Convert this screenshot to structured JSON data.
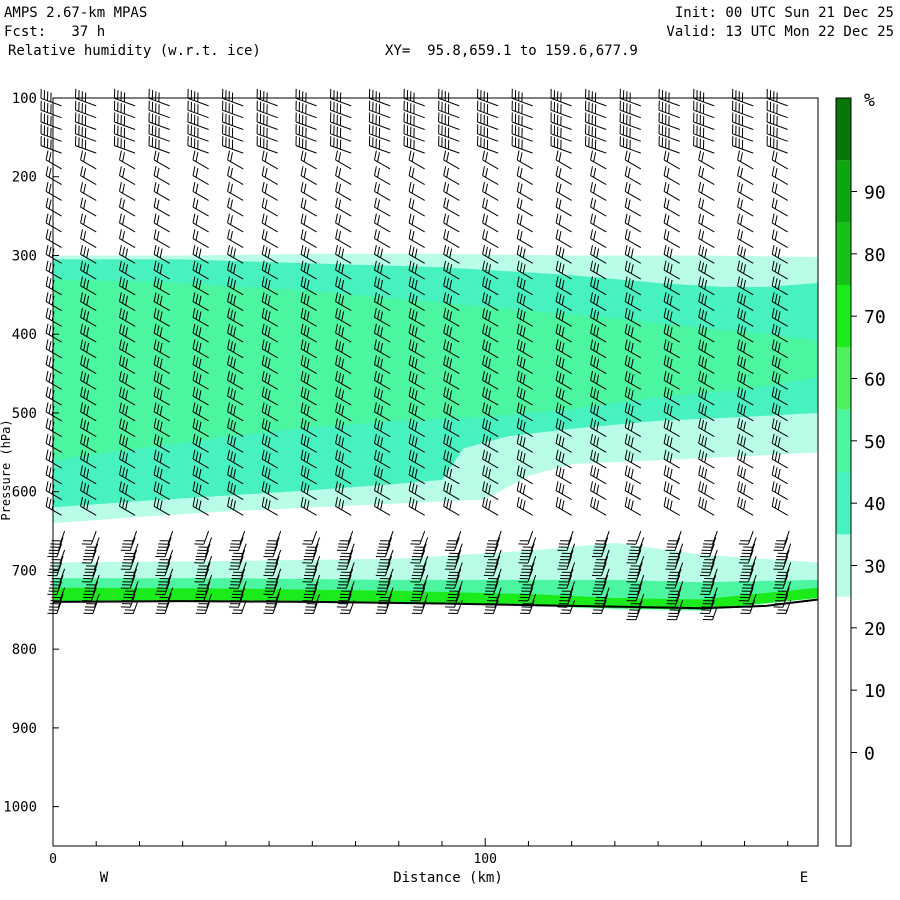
{
  "header": {
    "model": "AMPS 2.67-km MPAS",
    "fcst": "Fcst:   37 h",
    "field": "Relative humidity (w.r.t. ice)",
    "xy": "XY=  95.8,659.1 to 159.6,677.9",
    "init": "Init: 00 UTC Sun 21 Dec 25",
    "valid": "Valid: 13 UTC Mon 22 Dec 25"
  },
  "chart_data": {
    "type": "heatmap",
    "title": "Relative humidity (w.r.t. ice)",
    "xlabel": "Distance (km)",
    "ylabel": "Pressure (hPa)",
    "xlim": [
      0,
      177
    ],
    "ylim": [
      1050,
      100
    ],
    "x_ticks": [
      0,
      100
    ],
    "y_ticks": [
      100,
      200,
      300,
      400,
      500,
      600,
      700,
      800,
      900,
      1000
    ],
    "x_end_labels": {
      "left": "W",
      "right": "E"
    },
    "colorbar": {
      "unit": "%",
      "tick_labels": [
        "0",
        "10",
        "20",
        "30",
        "40",
        "50",
        "60",
        "70",
        "80",
        "90"
      ],
      "levels": [
        -10,
        0,
        10,
        20,
        30,
        40,
        50,
        60,
        70,
        80,
        90,
        100
      ],
      "colors": [
        "#ffffff",
        "#ffffff",
        "#ffffff",
        "#ffffff",
        "#b9fde9",
        "#48f2c0",
        "#4cf59f",
        "#4ff060",
        "#1bea1b",
        "#16c216",
        "#0ea60e",
        "#077607"
      ]
    },
    "regions": [
      {
        "name": "rh-40-50",
        "color": "#b9fde9",
        "upper": [
          [
            0,
            300
          ],
          [
            30,
            300
          ],
          [
            60,
            298
          ],
          [
            90,
            298
          ],
          [
            120,
            300
          ],
          [
            150,
            300
          ],
          [
            177,
            302
          ]
        ],
        "lower": [
          [
            0,
            640
          ],
          [
            20,
            632
          ],
          [
            40,
            625
          ],
          [
            60,
            620
          ],
          [
            80,
            615
          ],
          [
            100,
            610
          ],
          [
            110,
            580
          ],
          [
            120,
            565
          ],
          [
            140,
            560
          ],
          [
            160,
            555
          ],
          [
            177,
            550
          ]
        ]
      },
      {
        "name": "rh-50-60",
        "color": "#48f2c0",
        "upper": [
          [
            0,
            305
          ],
          [
            30,
            305
          ],
          [
            60,
            310
          ],
          [
            90,
            315
          ],
          [
            120,
            325
          ],
          [
            140,
            335
          ],
          [
            155,
            340
          ],
          [
            165,
            340
          ],
          [
            177,
            335
          ]
        ],
        "lower": [
          [
            0,
            620
          ],
          [
            20,
            612
          ],
          [
            40,
            605
          ],
          [
            60,
            598
          ],
          [
            80,
            590
          ],
          [
            90,
            585
          ],
          [
            95,
            545
          ],
          [
            105,
            530
          ],
          [
            120,
            520
          ],
          [
            140,
            510
          ],
          [
            160,
            505
          ],
          [
            177,
            500
          ]
        ]
      },
      {
        "name": "rh-60-70",
        "color": "#4cf59f",
        "upper": [
          [
            0,
            330
          ],
          [
            30,
            335
          ],
          [
            60,
            345
          ],
          [
            90,
            360
          ],
          [
            110,
            370
          ],
          [
            130,
            380
          ],
          [
            150,
            392
          ],
          [
            165,
            400
          ],
          [
            177,
            408
          ]
        ],
        "lower": [
          [
            0,
            560
          ],
          [
            20,
            545
          ],
          [
            40,
            530
          ],
          [
            60,
            518
          ],
          [
            80,
            510
          ],
          [
            100,
            505
          ],
          [
            120,
            495
          ],
          [
            140,
            480
          ],
          [
            160,
            470
          ],
          [
            177,
            455
          ]
        ]
      },
      {
        "name": "rh-40-50-low",
        "color": "#b9fde9",
        "upper": [
          [
            0,
            690
          ],
          [
            40,
            688
          ],
          [
            80,
            685
          ],
          [
            110,
            675
          ],
          [
            130,
            665
          ],
          [
            150,
            680
          ],
          [
            177,
            690
          ]
        ],
        "lower": [
          [
            0,
            740
          ],
          [
            40,
            740
          ],
          [
            80,
            742
          ],
          [
            110,
            745
          ],
          [
            130,
            750
          ],
          [
            150,
            752
          ],
          [
            177,
            735
          ]
        ]
      },
      {
        "name": "rh-60-70-low",
        "color": "#4cf59f",
        "upper": [
          [
            0,
            710
          ],
          [
            40,
            710
          ],
          [
            80,
            712
          ],
          [
            110,
            712
          ],
          [
            130,
            712
          ],
          [
            150,
            715
          ],
          [
            177,
            712
          ]
        ],
        "lower": [
          [
            0,
            740
          ],
          [
            40,
            740
          ],
          [
            80,
            742
          ],
          [
            110,
            745
          ],
          [
            130,
            748
          ],
          [
            150,
            750
          ],
          [
            177,
            735
          ]
        ]
      },
      {
        "name": "rh-80-90-low",
        "color": "#1bea1b",
        "upper": [
          [
            0,
            722
          ],
          [
            40,
            723
          ],
          [
            80,
            726
          ],
          [
            110,
            730
          ],
          [
            130,
            735
          ],
          [
            150,
            737
          ],
          [
            177,
            722
          ]
        ],
        "lower": [
          [
            0,
            740
          ],
          [
            40,
            740
          ],
          [
            80,
            742
          ],
          [
            110,
            745
          ],
          [
            130,
            748
          ],
          [
            150,
            750
          ],
          [
            177,
            735
          ]
        ]
      }
    ],
    "terrain_top": [
      [
        0,
        740
      ],
      [
        30,
        739
      ],
      [
        60,
        740
      ],
      [
        90,
        742
      ],
      [
        110,
        744
      ],
      [
        130,
        746
      ],
      [
        150,
        748
      ],
      [
        165,
        745
      ],
      [
        177,
        737
      ]
    ],
    "wind_barbs": {
      "columns_km": [
        2,
        10,
        19,
        27,
        36,
        44,
        52,
        61,
        69,
        78,
        86,
        94,
        103,
        111,
        120,
        128,
        136,
        145,
        153,
        162,
        170
      ],
      "levels_hpa_upper": [
        110,
        125,
        140,
        155,
        170,
        190,
        210,
        230,
        250,
        270,
        290,
        310,
        330,
        350,
        370,
        390,
        410,
        430,
        450,
        470,
        490,
        510,
        530,
        550,
        570,
        590,
        610,
        630
      ],
      "levels_hpa_lower_start": 650,
      "levels_hpa_lower_step": 8,
      "direction_deg_upper": 290,
      "direction_deg_mid": 300,
      "direction_deg_lower": 200
    }
  }
}
